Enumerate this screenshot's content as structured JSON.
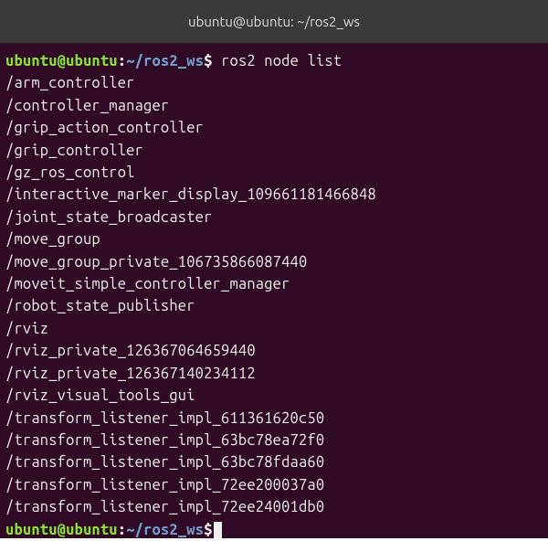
{
  "window": {
    "title": "ubuntu@ubuntu: ~/ros2_ws"
  },
  "prompt": {
    "user_host": "ubuntu@ubuntu",
    "colon": ":",
    "path": "~/ros2_ws",
    "symbol": "$"
  },
  "command": "ros2 node list",
  "output": [
    "/arm_controller",
    "/controller_manager",
    "/grip_action_controller",
    "/grip_controller",
    "/gz_ros_control",
    "/interactive_marker_display_109661181466848",
    "/joint_state_broadcaster",
    "/move_group",
    "/move_group_private_106735866087440",
    "/moveit_simple_controller_manager",
    "/robot_state_publisher",
    "/rviz",
    "/rviz_private_126367064659440",
    "/rviz_private_126367140234112",
    "/rviz_visual_tools_gui",
    "/transform_listener_impl_611361620c50",
    "/transform_listener_impl_63bc78ea72f0",
    "/transform_listener_impl_63bc78fdaa60",
    "/transform_listener_impl_72ee200037a0",
    "/transform_listener_impl_72ee24001db0"
  ]
}
